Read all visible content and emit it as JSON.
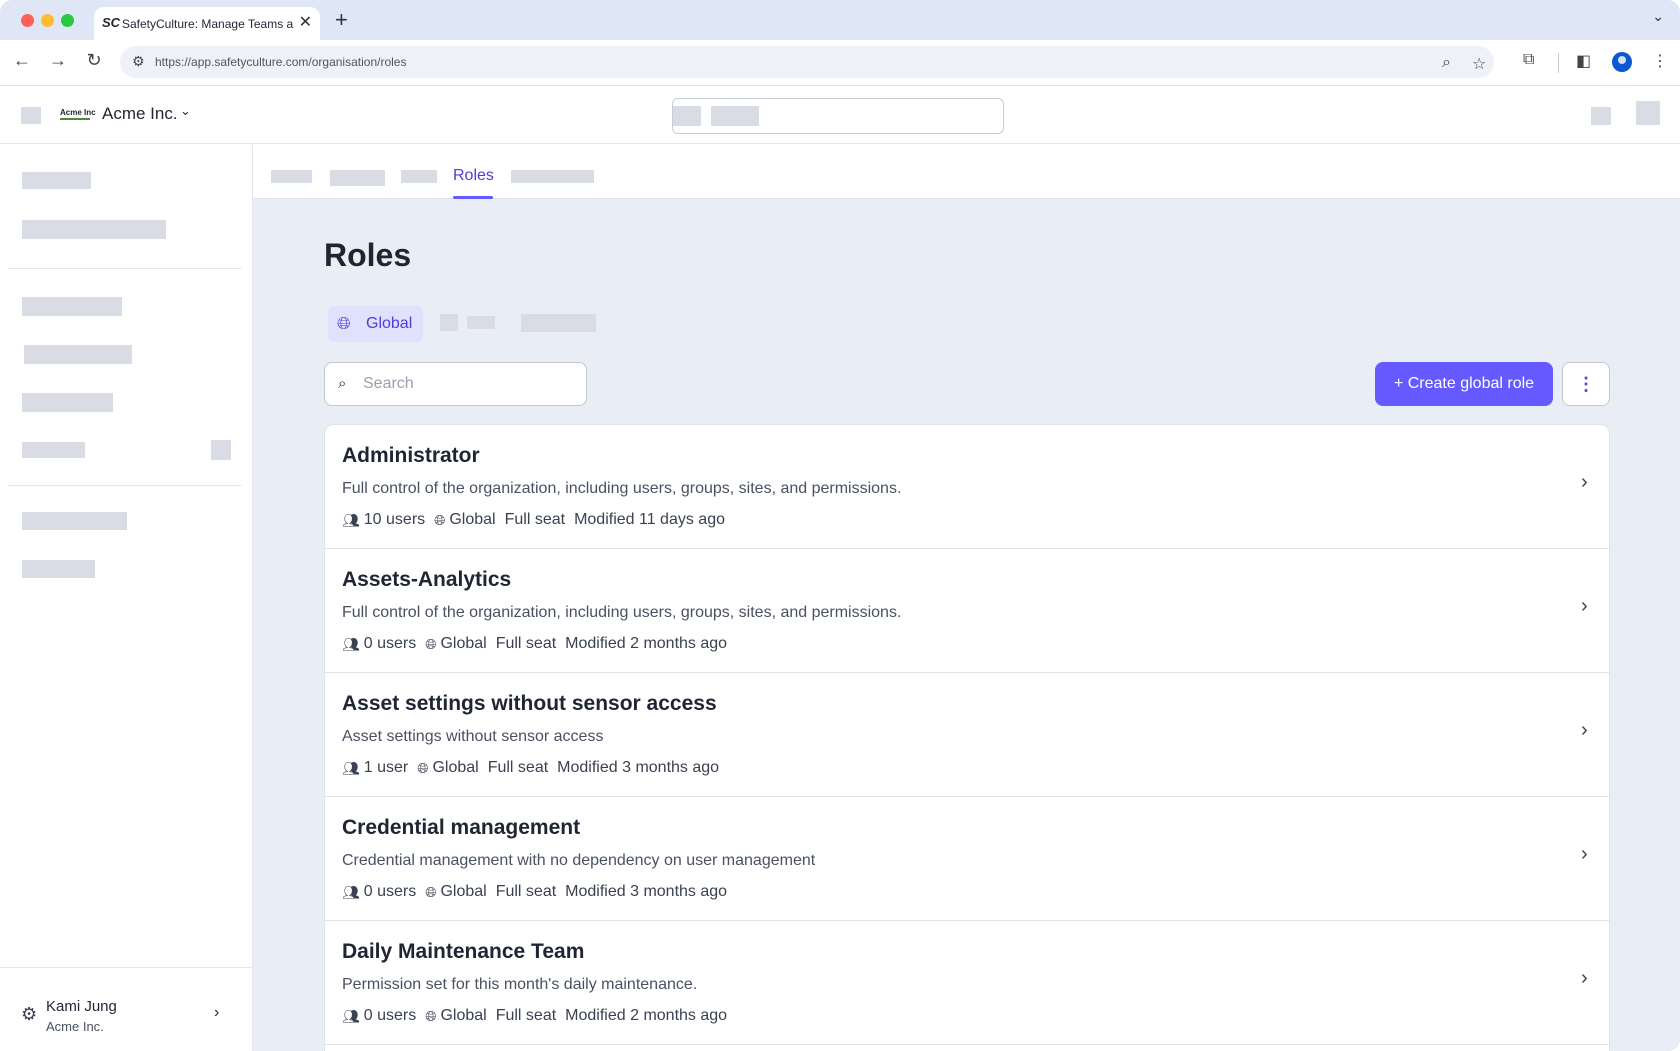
{
  "browser": {
    "tab_title": "SafetyCulture: Manage Teams and...",
    "tab_favicon": "SC",
    "url": "https://app.safetyculture.com/organisation/roles",
    "icons": [
      "back-icon",
      "forward-icon",
      "reload-icon",
      "site-settings-icon",
      "zoom-icon",
      "star-icon",
      "extensions-icon",
      "side-panel-icon",
      "profile-icon",
      "menu-icon"
    ]
  },
  "header": {
    "brand_logo": "Acme Inc",
    "org_name": "Acme Inc."
  },
  "subnav": {
    "active_tab": "Roles"
  },
  "page": {
    "title": "Roles",
    "scope_tab": "Global",
    "search_placeholder": "Search",
    "create_button": "+ Create global role"
  },
  "roles": [
    {
      "name": "Administrator",
      "description": "Full control of the organization, including users, groups, sites, and permissions.",
      "users": "10 users",
      "scope": "Global",
      "seat": "Full seat",
      "modified": "Modified 11 days ago"
    },
    {
      "name": "Assets-Analytics",
      "description": "Full control of the organization, including users, groups, sites, and permissions.",
      "users": "0 users",
      "scope": "Global",
      "seat": "Full seat",
      "modified": "Modified 2 months ago"
    },
    {
      "name": "Asset settings without sensor access",
      "description": "Asset settings without sensor access",
      "users": "1 user",
      "scope": "Global",
      "seat": "Full seat",
      "modified": "Modified 3 months ago"
    },
    {
      "name": "Credential management",
      "description": "Credential management with no dependency on user management",
      "users": "0 users",
      "scope": "Global",
      "seat": "Full seat",
      "modified": "Modified 3 months ago"
    },
    {
      "name": "Daily Maintenance Team",
      "description": "Permission set for this month's daily maintenance.",
      "users": "0 users",
      "scope": "Global",
      "seat": "Full seat",
      "modified": "Modified 2 months ago"
    }
  ],
  "sidebar_footer": {
    "user_name": "Kami Jung",
    "user_org": "Acme Inc."
  },
  "colors": {
    "accent": "#6559ff",
    "accent_text": "#4b3fdb",
    "page_background": "#e9edf5",
    "placeholder_block": "#d9dce5"
  }
}
